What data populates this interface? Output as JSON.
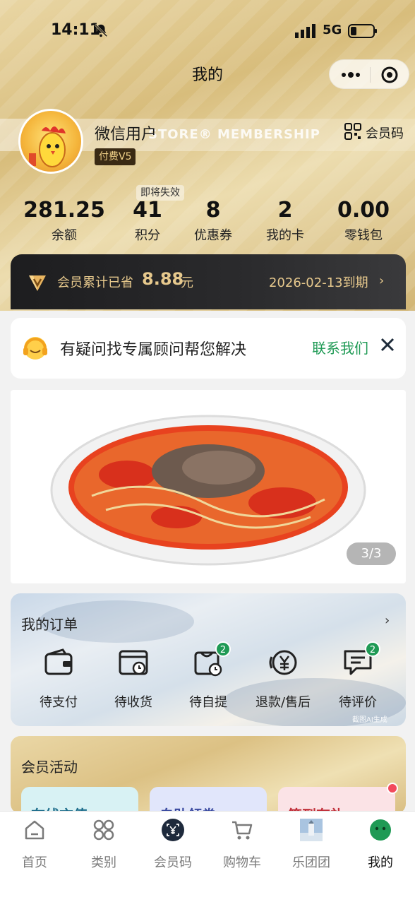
{
  "status_bar": {
    "time": "14:11",
    "network": "5G"
  },
  "nav": {
    "title": "我的"
  },
  "profile": {
    "username": "微信用户",
    "vip_level": "付费V5",
    "membership_watermark": "STORE® MEMBERSHIP",
    "member_code_label": "会员码"
  },
  "stats": {
    "expire_tag": "即将失效",
    "items": [
      {
        "value": "281.25",
        "label": "余额"
      },
      {
        "value": "41",
        "label": "积分"
      },
      {
        "value": "8",
        "label": "优惠券"
      },
      {
        "value": "2",
        "label": "我的卡"
      },
      {
        "value": "0.00",
        "label": "零钱包"
      }
    ]
  },
  "savings": {
    "text": "会员累计已省",
    "amount": "8.88",
    "unit": "元",
    "expire": "2026-02-13到期",
    "chevron": "›"
  },
  "advisor": {
    "message": "有疑问找专属顾问帮您解决",
    "contact_label": "联系我们"
  },
  "banner": {
    "pager": "3/3"
  },
  "orders": {
    "title": "我的订单",
    "more": "›",
    "items": [
      {
        "label": "待支付",
        "icon": "wallet-icon",
        "badge": ""
      },
      {
        "label": "待收货",
        "icon": "delivery-box-icon",
        "badge": ""
      },
      {
        "label": "待自提",
        "icon": "pickup-bag-icon",
        "badge": "2"
      },
      {
        "label": "退款/售后",
        "icon": "refund-yen-icon",
        "badge": ""
      },
      {
        "label": "待评价",
        "icon": "comment-icon",
        "badge": "2"
      }
    ],
    "ai_mark": "截图AI生成"
  },
  "activities": {
    "title": "会员活动",
    "cards": [
      {
        "title": "在线充值",
        "color": "#1f6e8c"
      },
      {
        "title": "自助领券",
        "color": "#3a4aa0"
      },
      {
        "title": "签到有礼",
        "color": "#c0303a"
      }
    ]
  },
  "tabbar": {
    "items": [
      {
        "label": "首页",
        "icon": "home-icon"
      },
      {
        "label": "类别",
        "icon": "category-icon"
      },
      {
        "label": "会员码",
        "icon": "member-code-icon"
      },
      {
        "label": "购物车",
        "icon": "cart-icon"
      },
      {
        "label": "乐团团",
        "icon": "group-thumbnail-icon"
      },
      {
        "label": "我的",
        "icon": "profile-icon"
      }
    ],
    "active_index": 5
  },
  "colors": {
    "accent_green": "#1f9a55",
    "gold": "#e7c98d",
    "badge_red": "#f24a5c"
  }
}
